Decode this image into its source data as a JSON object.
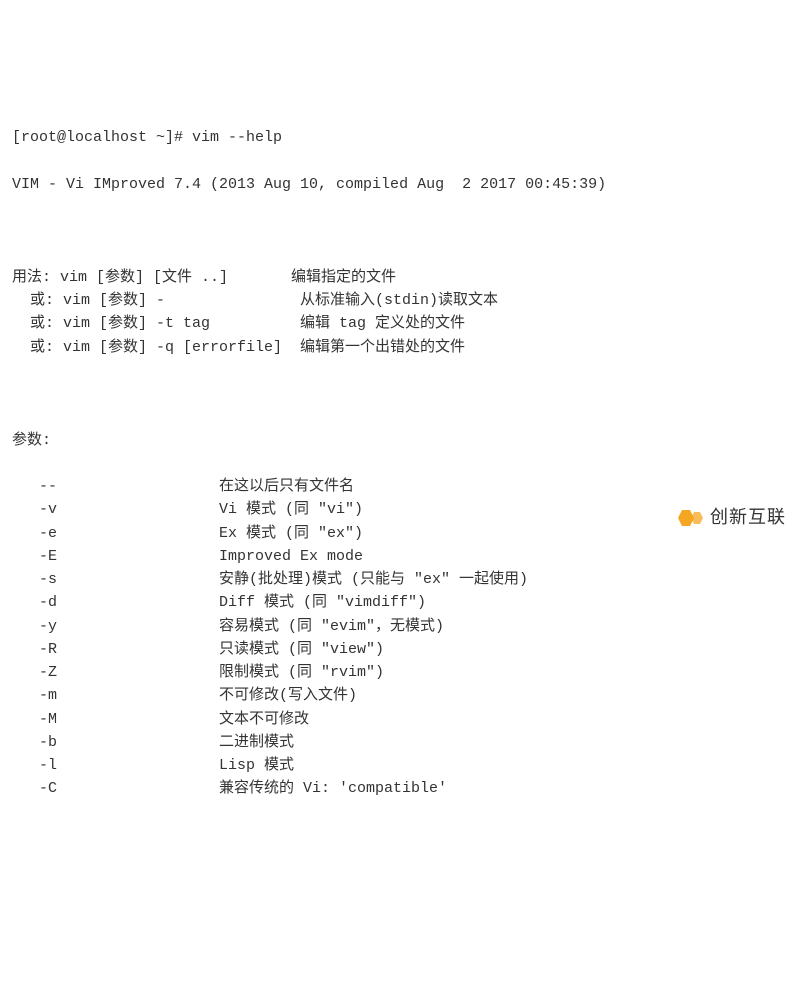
{
  "prompt_line": "[root@localhost ~]# vim --help",
  "version_line": "VIM - Vi IMproved 7.4 (2013 Aug 10, compiled Aug  2 2017 00:45:39)",
  "usage_header": "用法:",
  "usage_lines": [
    {
      "prefix": "用法:",
      "cmd": "vim [参数] [文件 ..]     ",
      "desc": "编辑指定的文件"
    },
    {
      "prefix": "  或:",
      "cmd": "vim [参数] -             ",
      "desc": "从标准输入(stdin)读取文本"
    },
    {
      "prefix": "  或:",
      "cmd": "vim [参数] -t tag        ",
      "desc": "编辑 tag 定义处的文件"
    },
    {
      "prefix": "  或:",
      "cmd": "vim [参数] -q [errorfile]",
      "desc": "编辑第一个出错处的文件"
    }
  ],
  "params_header": "参数:",
  "params": [
    {
      "flag": "--",
      "desc": "在这以后只有文件名"
    },
    {
      "flag": "-v",
      "desc": "Vi 模式 (同 \"vi\")"
    },
    {
      "flag": "-e",
      "desc": "Ex 模式 (同 \"ex\")"
    },
    {
      "flag": "-E",
      "desc": "Improved Ex mode"
    },
    {
      "flag": "-s",
      "desc": "安静(批处理)模式 (只能与 \"ex\" 一起使用)"
    },
    {
      "flag": "-d",
      "desc": "Diff 模式 (同 \"vimdiff\")"
    },
    {
      "flag": "-y",
      "desc": "容易模式 (同 \"evim\"，无模式)"
    },
    {
      "flag": "-R",
      "desc": "只读模式 (同 \"view\")"
    },
    {
      "flag": "-Z",
      "desc": "限制模式 (同 \"rvim\")"
    },
    {
      "flag": "-m",
      "desc": "不可修改(写入文件)"
    },
    {
      "flag": "-M",
      "desc": "文本不可修改"
    },
    {
      "flag": "-b",
      "desc": "二进制模式"
    },
    {
      "flag": "-l",
      "desc": "Lisp 模式"
    },
    {
      "flag": "-C",
      "desc": "兼容传统的 Vi: 'compatible'"
    }
  ],
  "watermark_text": "创新互联"
}
